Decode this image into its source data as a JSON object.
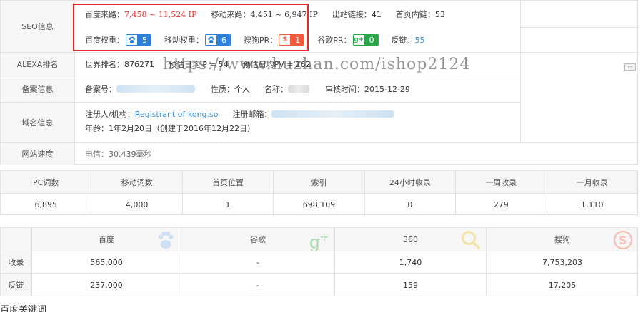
{
  "seo": {
    "label": "SEO信息",
    "baidu_traffic_label": "百度来路：",
    "baidu_traffic_value": "7,458 ~ 11,524 IP",
    "mobile_traffic_label": "移动来路：",
    "mobile_traffic_value": "4,451 ~ 6,947 IP",
    "outlinks_label": "出站链接：",
    "outlinks_value": "41",
    "homepage_links_label": "首页内链：",
    "homepage_links_value": "53",
    "baidu_weight_label": "百度权重：",
    "baidu_weight_value": "5",
    "mobile_weight_label": "移动权重：",
    "mobile_weight_value": "6",
    "sogou_pr_label": "搜狗PR：",
    "sogou_pr_value": "1",
    "google_pr_label": "谷歌PR：",
    "google_pr_value": "0",
    "backlinks_label": "反链：",
    "backlinks_value": "55"
  },
  "alexa": {
    "label": "ALEXA排名",
    "world_rank_label": "世界排名：",
    "world_rank_value": "876271",
    "daily_ip_label": "预估日均IP ≈",
    "daily_ip_value": "54",
    "daily_pv_label": "预估日均PV ≈",
    "daily_pv_value": "162"
  },
  "watermark": "https://www.huzhan.com/ishop2124",
  "icp": {
    "label": "备案信息",
    "number_label": "备案号：",
    "nature_label": "性质：",
    "nature_value": "个人",
    "name_label": "名称：",
    "audit_label": "审核时间：",
    "audit_value": "2015-12-29"
  },
  "domain": {
    "label": "域名信息",
    "registrant_label": "注册人/机构：",
    "registrant_value": "Registrant of kong.so",
    "email_label": "注册邮箱：",
    "age_label": "年龄：",
    "age_value": "1年2月20日（创建于2016年12月22日）"
  },
  "speed": {
    "label": "网站速度",
    "value": "电信：30.439毫秒"
  },
  "stats": {
    "headers": [
      "PC词数",
      "移动词数",
      "首页位置",
      "索引",
      "24小时收录",
      "一周收录",
      "一月收录"
    ],
    "values": [
      "6,895",
      "4,000",
      "1",
      "698,109",
      "0",
      "279",
      "1,110"
    ]
  },
  "engines": {
    "headers": [
      "百度",
      "谷歌",
      "360",
      "搜狗"
    ],
    "icons": [
      "paw-icon",
      "google-plus-icon",
      "magnifier-icon",
      "sogou-icon"
    ],
    "rows": [
      {
        "label": "收录",
        "values": [
          "565,000",
          "-",
          "1,740",
          "7,753,203"
        ]
      },
      {
        "label": "反链",
        "values": [
          "237,000",
          "-",
          "159",
          "17,205"
        ]
      }
    ]
  },
  "bottom_title": "百度关键词",
  "colors": {
    "highlight_border": "#e32b2b",
    "baidu_blue": "#2e7fd9",
    "sogou_red": "#f05a3e",
    "google_green": "#2aa54a",
    "link_blue": "#3a8fd6"
  }
}
